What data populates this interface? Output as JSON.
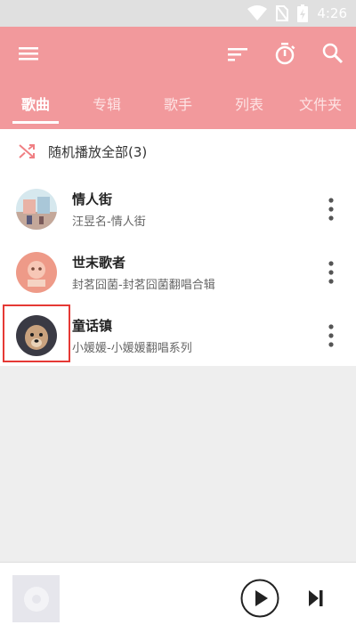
{
  "status_bar": {
    "time": "4:26",
    "icons": [
      "wifi-icon",
      "no-sim-icon",
      "battery-charging-icon"
    ]
  },
  "toolbar": {
    "icons": [
      "menu-icon",
      "sort-icon",
      "timer-icon",
      "search-icon"
    ]
  },
  "tabs": [
    {
      "label": "歌曲",
      "active": true
    },
    {
      "label": "专辑",
      "active": false
    },
    {
      "label": "歌手",
      "active": false
    },
    {
      "label": "列表",
      "active": false
    },
    {
      "label": "文件夹",
      "active": false
    }
  ],
  "shuffle": {
    "label": "随机播放全部(3)",
    "icon": "shuffle-icon"
  },
  "songs": [
    {
      "title": "情人街",
      "subtitle": "汪昱名-情人街"
    },
    {
      "title": "世末歌者",
      "subtitle": "封茗囧菌-封茗囧菌翻唱合辑"
    },
    {
      "title": "童话镇",
      "subtitle": "小媛媛-小媛媛翻唱系列"
    }
  ],
  "player": {
    "icons": [
      "album-placeholder-icon",
      "play-icon",
      "skip-next-icon"
    ]
  },
  "colors": {
    "primary": "#f2999c",
    "accent_red": "#e53935",
    "background": "#eeeeee"
  }
}
